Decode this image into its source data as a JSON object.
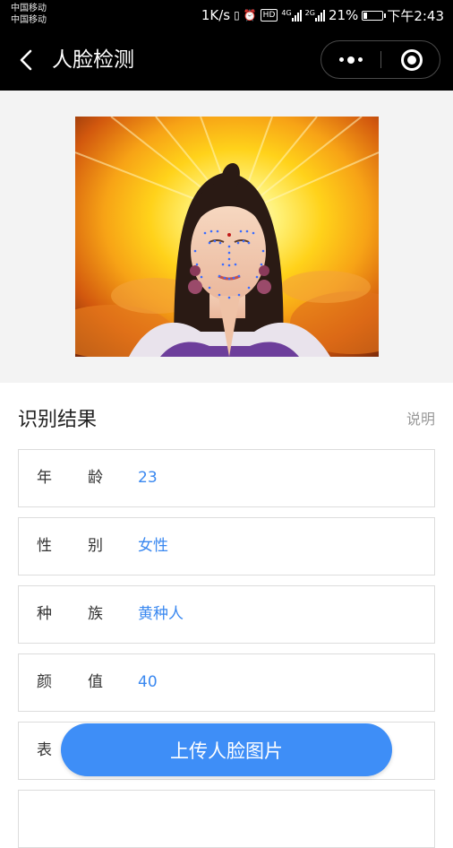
{
  "status_bar": {
    "carrier_1": "中国移动",
    "carrier_2": "中国移动",
    "net_speed": "1K/s",
    "hd_label": "HD",
    "sig1_tag": "4G",
    "sig2_tag": "2G",
    "battery_percent": "21%",
    "battery_level": 0.21,
    "time": "下午2:43"
  },
  "nav": {
    "title": "人脸检测"
  },
  "result": {
    "title": "识别结果",
    "explain_link": "说明",
    "rows": [
      {
        "label_a": "年",
        "label_b": "龄",
        "value": "23"
      },
      {
        "label_a": "性",
        "label_b": "别",
        "value": "女性"
      },
      {
        "label_a": "种",
        "label_b": "族",
        "value": "黄种人"
      },
      {
        "label_a": "颜",
        "label_b": "值",
        "value": "40"
      },
      {
        "label_a": "表",
        "label_b": "",
        "value": ""
      }
    ]
  },
  "upload_button": "上传人脸图片",
  "colors": {
    "accent": "#3e8ef7",
    "value_text": "#3a88f0",
    "nav_bg": "#000000",
    "landmark": "#3b6cff"
  }
}
